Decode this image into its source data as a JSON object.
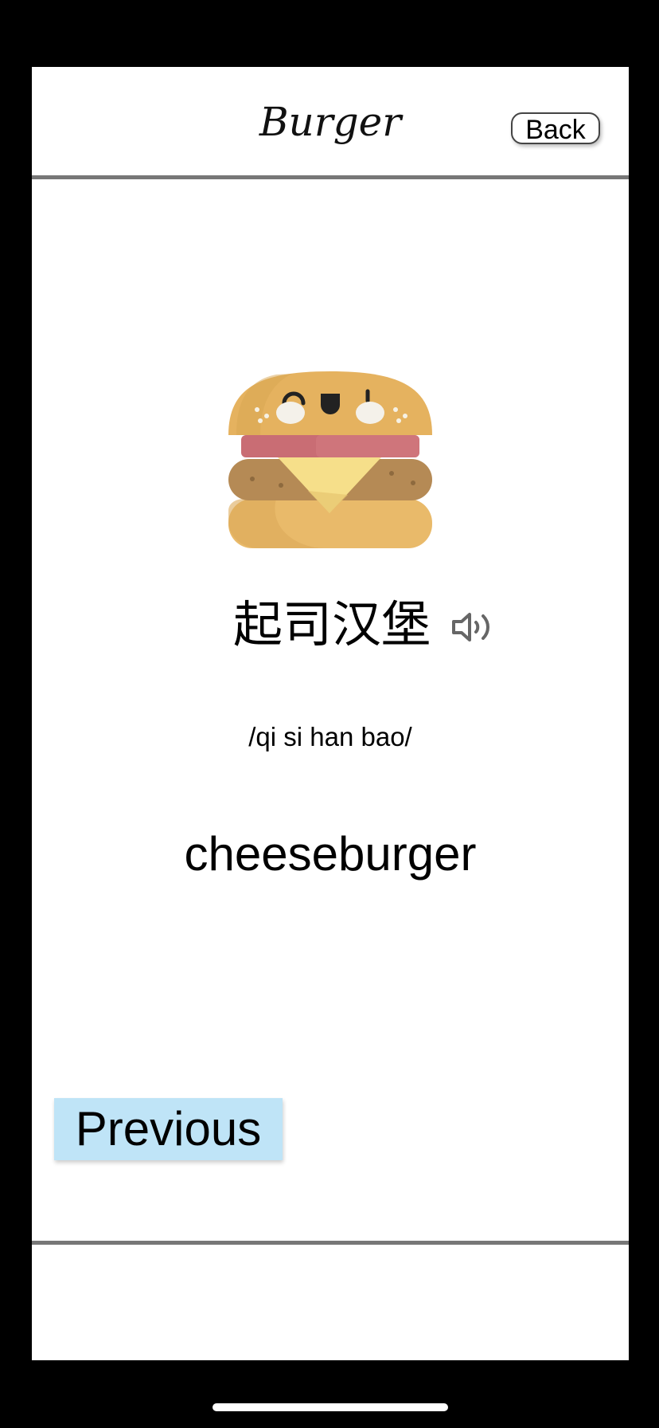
{
  "header": {
    "title": "Burger",
    "back_label": "Back"
  },
  "card": {
    "image_icon": "cheeseburger-icon",
    "chinese": "起司汉堡",
    "sound_icon": "speaker-icon",
    "pinyin": "/qi si han bao/",
    "english": "cheeseburger"
  },
  "nav": {
    "previous_label": "Previous"
  },
  "colors": {
    "previous_button_bg": "#bfe4f7",
    "divider": "#777777"
  }
}
